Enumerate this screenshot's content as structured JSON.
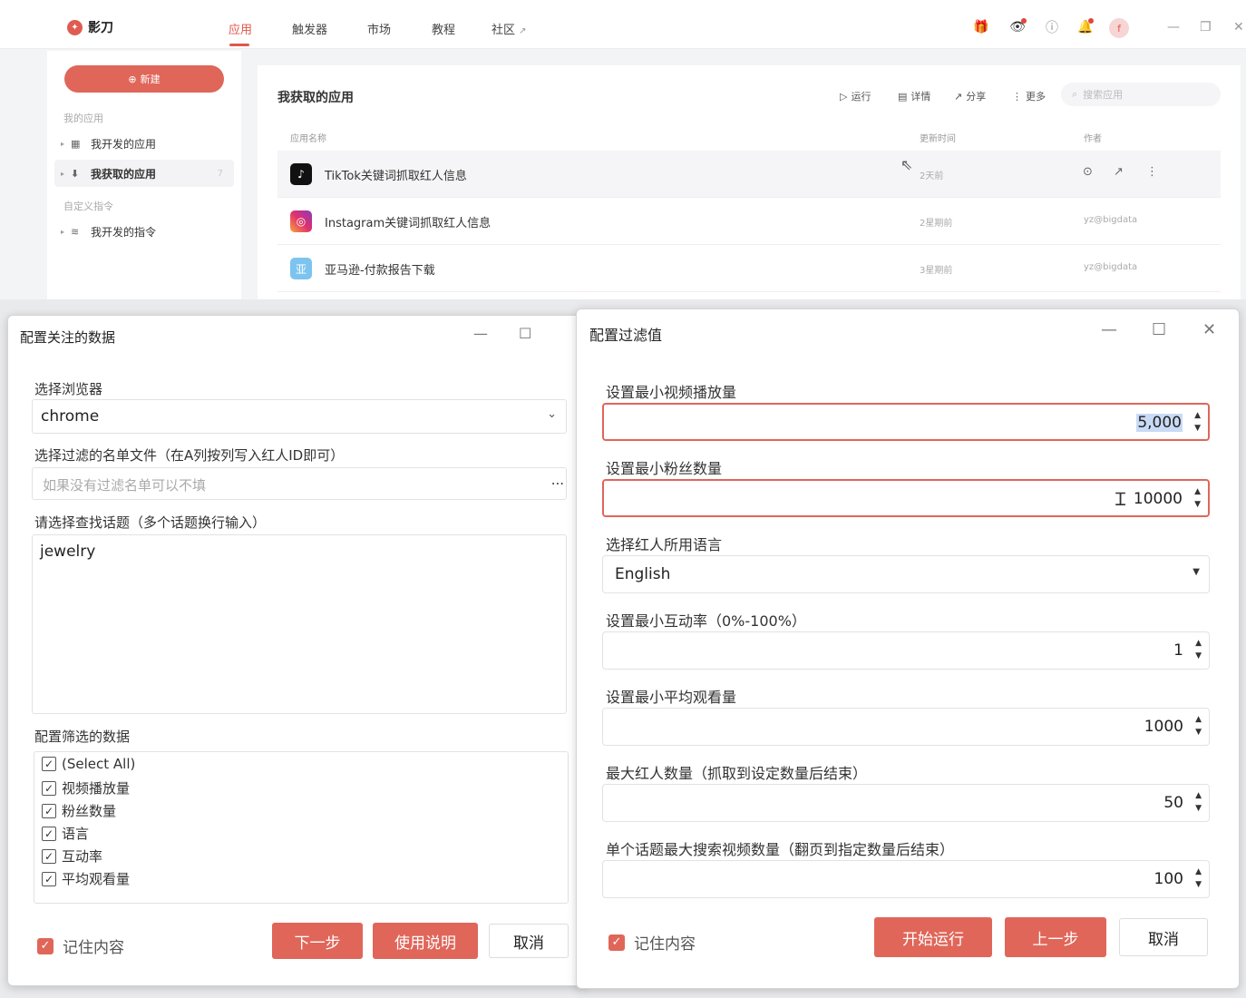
{
  "app": {
    "name": "影刀",
    "nav": [
      "应用",
      "触发器",
      "市场",
      "教程",
      "社区"
    ],
    "avatar_letter": "f",
    "sidebar": {
      "new_label": "新建",
      "my_apps_label": "我的应用",
      "items": [
        {
          "label": "我开发的应用"
        },
        {
          "label": "我获取的应用",
          "count": "7"
        }
      ],
      "custom_cmd_label": "自定义指令",
      "cmd_items": [
        {
          "label": "我开发的指令"
        }
      ]
    },
    "main": {
      "title": "我获取的应用",
      "actions": [
        "运行",
        "详情",
        "分享",
        "更多"
      ],
      "search_placeholder": "搜索应用",
      "columns": [
        "应用名称",
        "更新时间",
        "作者"
      ],
      "rows": [
        {
          "name": "TikTok关键词抓取红人信息",
          "time": "2天前",
          "author": ""
        },
        {
          "name": "Instagram关键词抓取红人信息",
          "time": "2星期前",
          "author": "yz@bigdata"
        },
        {
          "name": "亚马逊-付款报告下载",
          "time": "3星期前",
          "author": "yz@bigdata",
          "icon_char": "亚"
        }
      ]
    }
  },
  "dialog_left": {
    "title": "配置关注的数据",
    "browser_label": "选择浏览器",
    "browser_value": "chrome",
    "filter_file_label": "选择过滤的名单文件（在A列按列写入红人ID即可）",
    "filter_file_placeholder": "如果没有过滤名单可以不填",
    "filter_file_more": "...",
    "topic_label": "请选择查找话题（多个话题换行输入）",
    "topic_value": "jewelry",
    "data_label": "配置筛选的数据",
    "checkboxes": [
      "(Select All)",
      "视频播放量",
      "粉丝数量",
      "语言",
      "互动率",
      "平均观看量"
    ],
    "remember_label": "记住内容",
    "next_label": "下一步",
    "help_label": "使用说明",
    "cancel_label": "取消"
  },
  "dialog_right": {
    "title": "配置过滤值",
    "fields": [
      {
        "label": "设置最小视频播放量",
        "value": "5,000"
      },
      {
        "label": "设置最小粉丝数量",
        "value": "10000"
      },
      {
        "label": "选择红人所用语言",
        "value": "English"
      },
      {
        "label": "设置最小互动率（0%-100%）",
        "value": "1"
      },
      {
        "label": "设置最小平均观看量",
        "value": "1000"
      },
      {
        "label": "最大红人数量（抓取到设定数量后结束）",
        "value": "50"
      },
      {
        "label": "单个话题最大搜索视频数量（翻页到指定数量后结束）",
        "value": "100"
      }
    ],
    "remember_label": "记住内容",
    "start_label": "开始运行",
    "prev_label": "上一步",
    "cancel_label": "取消"
  },
  "colors": {
    "accent": "#e0665a",
    "nav_active": "#e0574b"
  }
}
